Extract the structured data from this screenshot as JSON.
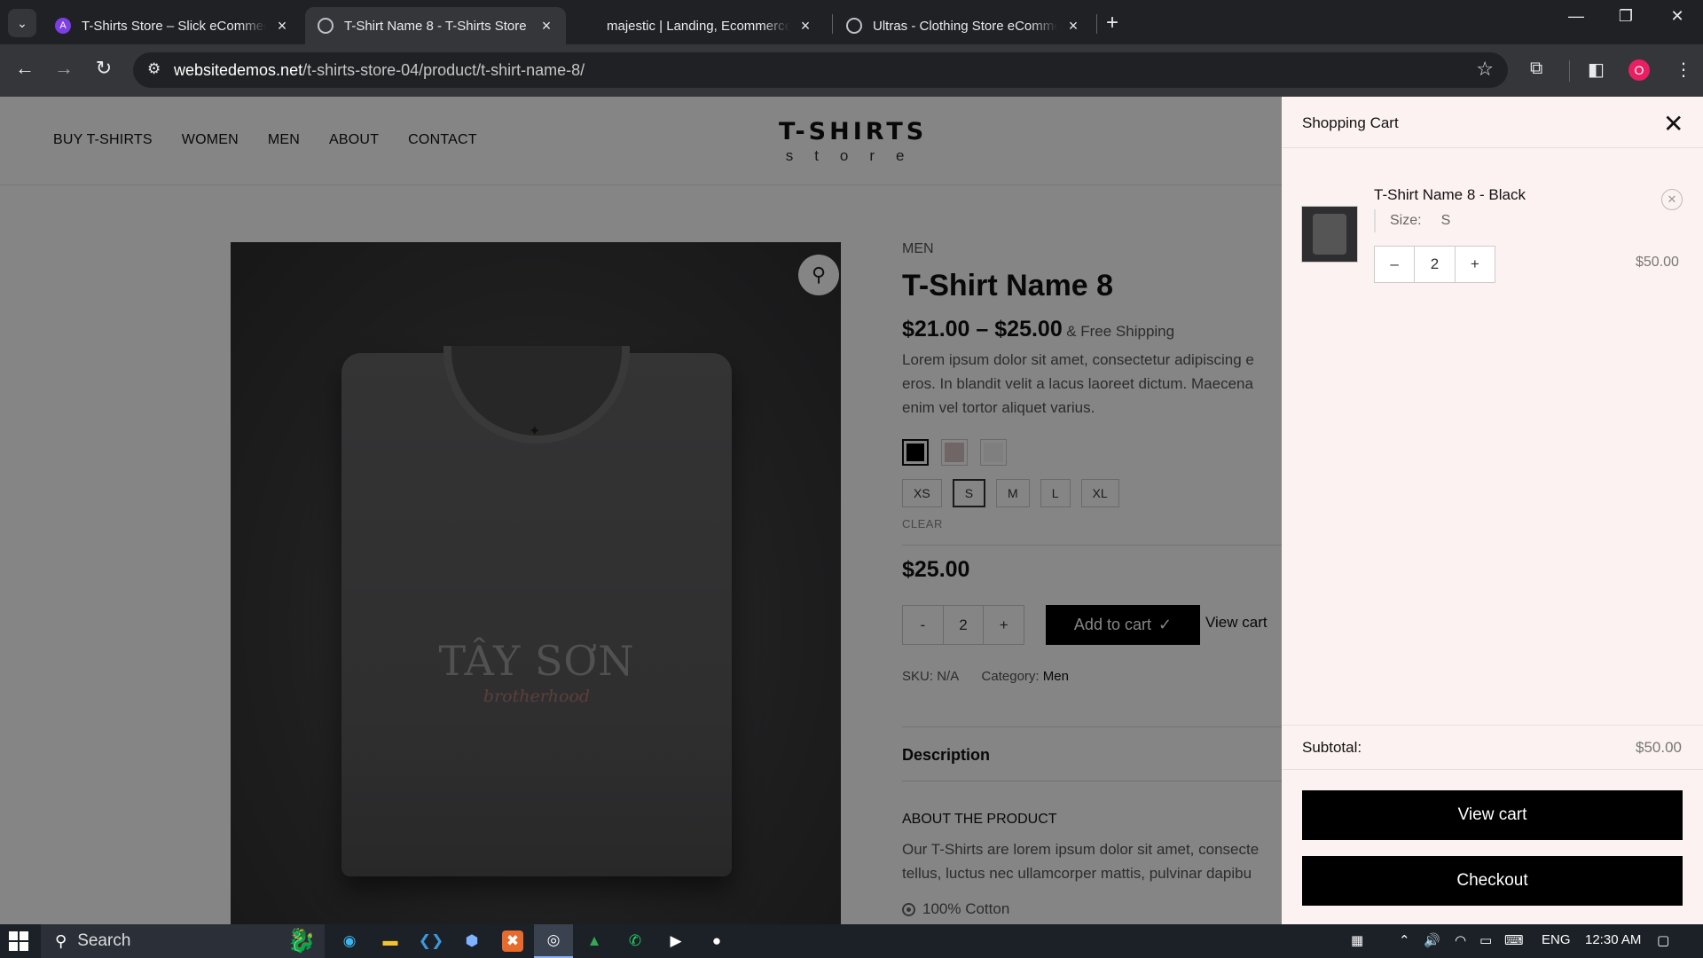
{
  "browser": {
    "tabs": [
      {
        "title": "T-Shirts Store – Slick eCommerce",
        "favicon_color": "#7b3fe4",
        "favicon_glyph": "A",
        "active": false
      },
      {
        "title": "T-Shirt Name 8 - T-Shirts Store",
        "favicon_color": "#5f6368",
        "favicon_glyph": "🌐",
        "active": true
      },
      {
        "title": "majestic | Landing, Ecommerce",
        "favicon_color": "",
        "favicon_glyph": "",
        "active": false
      },
      {
        "title": "Ultras - Clothing Store eCommerce",
        "favicon_color": "#5f6368",
        "favicon_glyph": "🌐",
        "active": false
      }
    ],
    "url_host": "websitedemos.net",
    "url_path": "/t-shirts-store-04/product/t-shirt-name-8/",
    "profile_initial": "O",
    "icons": [
      "tab-search-icon",
      "back-icon",
      "forward-icon",
      "reload-icon",
      "site-info-icon",
      "bookmark-star-icon",
      "extensions-icon",
      "side-panel-icon",
      "menu-icon",
      "minimize-icon",
      "restore-icon",
      "close-icon",
      "new-tab-icon"
    ]
  },
  "site": {
    "nav": [
      "BUY T-SHIRTS",
      "WOMEN",
      "MEN",
      "ABOUT",
      "CONTACT"
    ],
    "logo_main": "T-SHIRTS",
    "logo_sub": "store"
  },
  "product": {
    "image_text_main": "TÂY SƠN",
    "image_text_sub": "brotherhood",
    "category": "MEN",
    "title": "T-Shirt Name 8",
    "price_range": "$21.00 – $25.00",
    "shipping": "& Free Shipping",
    "description": [
      "Lorem ipsum dolor sit amet, consectetur adipiscing e",
      "eros. In blandit velit a lacus laoreet dictum. Maecena",
      "enim vel tortor aliquet varius."
    ],
    "swatches": [
      {
        "color": "#000000",
        "selected": true
      },
      {
        "color": "#d9c3c3",
        "selected": false
      },
      {
        "color": "#f4f4f4",
        "selected": false
      }
    ],
    "sizes": [
      {
        "label": "XS",
        "selected": false
      },
      {
        "label": "S",
        "selected": true
      },
      {
        "label": "M",
        "selected": false
      },
      {
        "label": "L",
        "selected": false
      },
      {
        "label": "XL",
        "selected": false
      }
    ],
    "clear_label": "CLEAR",
    "variation_price": "$25.00",
    "quantity": "2",
    "qty_minus": "-",
    "qty_plus": "+",
    "add_to_cart": "Add to cart",
    "view_cart_link": "View cart",
    "sku_label": "SKU:",
    "sku_value": "N/A",
    "category_label": "Category:",
    "category_value": "Men",
    "tab_description": "Description",
    "about_heading": "ABOUT THE PRODUCT",
    "about_text": [
      "Our T-Shirts are lorem ipsum dolor sit amet, consecte",
      "tellus, luctus nec ullamcorper mattis, pulvinar dapibu"
    ],
    "bullet": "100% Cotton"
  },
  "cart": {
    "title": "Shopping Cart",
    "item_name": "T-Shirt Name 8 - Black",
    "size_label": "Size:",
    "size_value": "S",
    "quantity": "2",
    "qty_minus": "–",
    "qty_plus": "+",
    "item_price": "$50.00",
    "subtotal_label": "Subtotal:",
    "subtotal_value": "$50.00",
    "view_cart": "View cart",
    "checkout": "Checkout"
  },
  "taskbar": {
    "search_label": "Search",
    "language": "ENG",
    "time": "12:30 AM"
  }
}
